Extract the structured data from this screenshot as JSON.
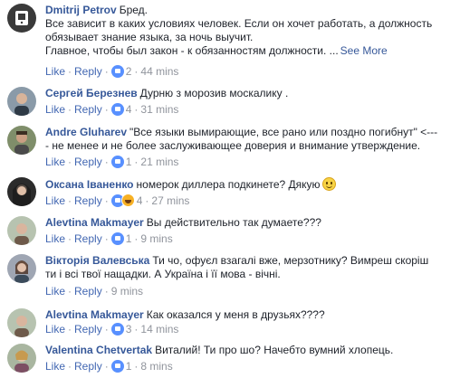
{
  "actions": {
    "like": "Like",
    "reply": "Reply",
    "dot": "·"
  },
  "comments": [
    {
      "author": "Dmitrij Petrov",
      "text": "Бред.",
      "lines": [
        "Все зависит в каких условиях человек. Если он хочет работать, а должность",
        "обязывает знание языка, за ночь выучит.",
        "Главное, чтобы был закон - к обязанностям должности. ..."
      ],
      "see_more": "See More",
      "reactions": "2",
      "time": "44 mins"
    },
    {
      "author": "Сергей Березнев",
      "text": "Дурню з морозив москалику .",
      "reactions": "4",
      "time": "31 mins"
    },
    {
      "author": "Andre Gluharev",
      "text": "\"Все языки вымирающие, все рано или поздно погибнут\" <---",
      "lines": [
        "- не менее и не более заслуживающее доверия и внимание утверждение."
      ],
      "reactions": "1",
      "time": "21 mins"
    },
    {
      "author": "Оксана Іваненко",
      "text": "номерок диллера подкинете? Дякую",
      "reactions": "4",
      "time": "27 mins"
    },
    {
      "author": "Alevtina Makmayer",
      "text": "Вы действительно так думаете???",
      "reactions": "1",
      "time": "9 mins"
    },
    {
      "author": "Вікторія Валевська",
      "text": "Ти чо, офуєл взагалі вже, мерзотнику? Вимреш скоріш",
      "lines": [
        "ти і всі твої нащадки. А Україна і її мова - вічні."
      ],
      "time": "9 mins"
    },
    {
      "author": "Alevtina Makmayer",
      "text": "Как оказался у меня в друзьях????",
      "reactions": "3",
      "time": "14 mins"
    },
    {
      "author": "Valentina Chetvertak",
      "text": "Виталий! Ти про шо? Начебто вумний хлопець.",
      "reactions": "1",
      "time": "8 mins"
    }
  ]
}
